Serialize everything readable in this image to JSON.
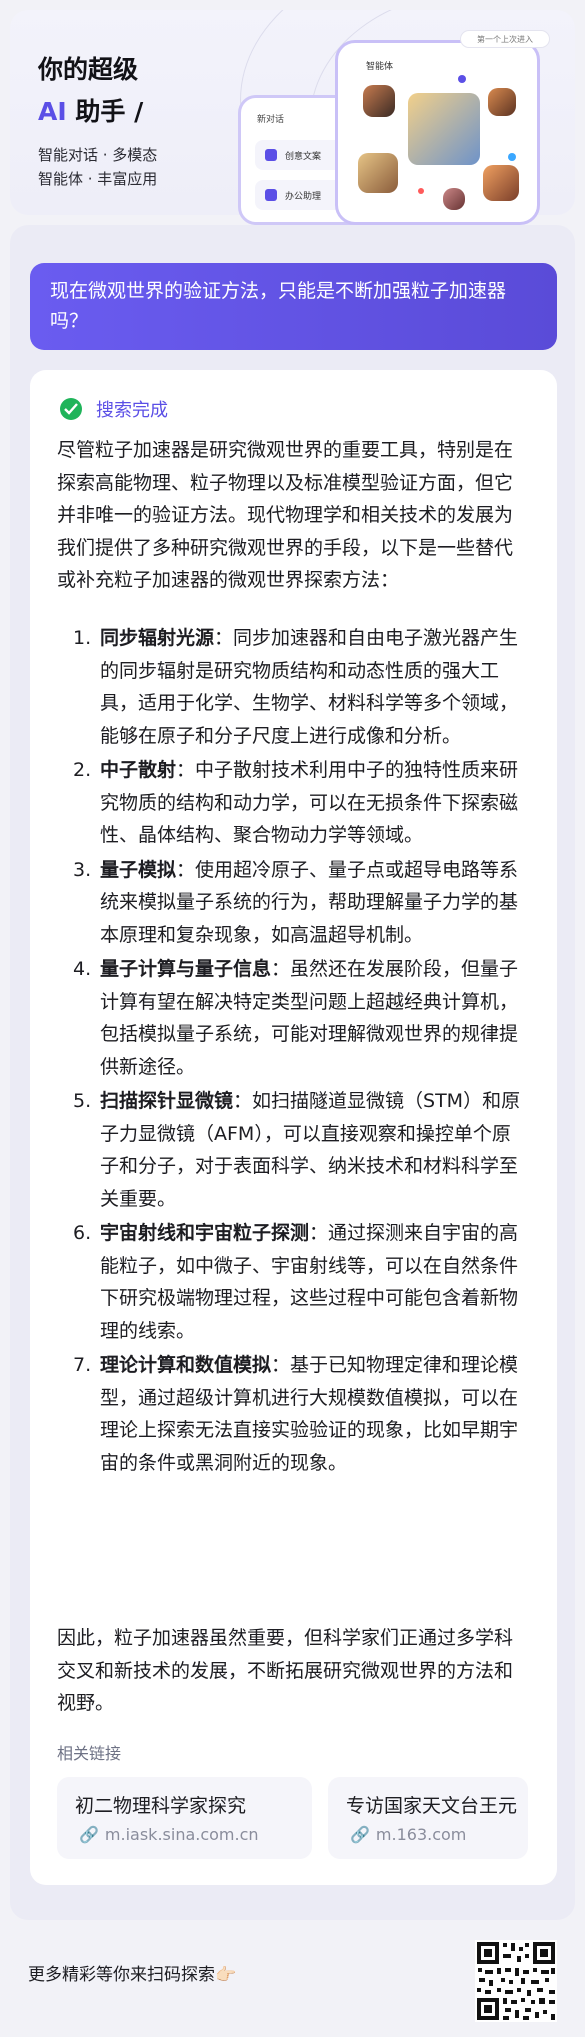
{
  "header": {
    "title_line1": "你的超级",
    "title_line2_accent": "AI",
    "title_line2_rest": " 助手 /",
    "subtitle_line1": "智能对话 · 多模态",
    "subtitle_line2": "智能体 · 丰富应用",
    "mock_front_title": "智能体",
    "mock_back_title": "新对话",
    "mock_chip1": "创意文案",
    "mock_chip2": "办公助理",
    "mock_badge": "第一个上次进入"
  },
  "question": "现在微观世界的验证方法，只能是不断加强粒子加速器吗？",
  "answer": {
    "status": "搜索完成",
    "intro": "尽管粒子加速器是研究微观世界的重要工具，特别是在探索高能物理、粒子物理以及标准模型验证方面，但它并非唯一的验证方法。现代物理学和相关技术的发展为我们提供了多种研究微观世界的手段，以下是一些替代或补充粒子加速器的微观世界探索方法：",
    "items": [
      {
        "num": "1.",
        "title": "同步辐射光源",
        "text": "：同步加速器和自由电子激光器产生的同步辐射是研究物质结构和动态性质的强大工具，适用于化学、生物学、材料科学等多个领域，能够在原子和分子尺度上进行成像和分析。"
      },
      {
        "num": "2.",
        "title": "中子散射",
        "text": "：中子散射技术利用中子的独特性质来研究物质的结构和动力学，可以在无损条件下探索磁性、晶体结构、聚合物动力学等领域。"
      },
      {
        "num": "3.",
        "title": "量子模拟",
        "text": "：使用超冷原子、量子点或超导电路等系统来模拟量子系统的行为，帮助理解量子力学的基本原理和复杂现象，如高温超导机制。"
      },
      {
        "num": "4.",
        "title": "量子计算与量子信息",
        "text": "：虽然还在发展阶段，但量子计算有望在解决特定类型问题上超越经典计算机，包括模拟量子系统，可能对理解微观世界的规律提供新途径。"
      },
      {
        "num": "5.",
        "title": "扫描探针显微镜",
        "text": "：如扫描隧道显微镜（STM）和原子力显微镜（AFM），可以直接观察和操控单个原子和分子，对于表面科学、纳米技术和材料科学至关重要。"
      },
      {
        "num": "6.",
        "title": "宇宙射线和宇宙粒子探测",
        "text": "：通过探测来自宇宙的高能粒子，如中微子、宇宙射线等，可以在自然条件下研究极端物理过程，这些过程中可能包含着新物理的线索。"
      },
      {
        "num": "7.",
        "title": "理论计算和数值模拟",
        "text": "：基于已知物理定律和理论模型，通过超级计算机进行大规模数值模拟，可以在理论上探索无法直接实验验证的现象，比如早期宇宙的条件或黑洞附近的现象。"
      }
    ],
    "outro": "因此，粒子加速器虽然重要，但科学家们正通过多学科交叉和新技术的发展，不断拓展研究微观世界的方法和视野。",
    "related_title": "相关链接",
    "links": [
      {
        "title": "初二物理科学家探究",
        "url": "m.iask.sina.com.cn"
      },
      {
        "title": "专访国家天文台王元",
        "url": "m.163.com"
      }
    ]
  },
  "footer": {
    "text": "更多精彩等你来扫码探索👉🏻"
  }
}
